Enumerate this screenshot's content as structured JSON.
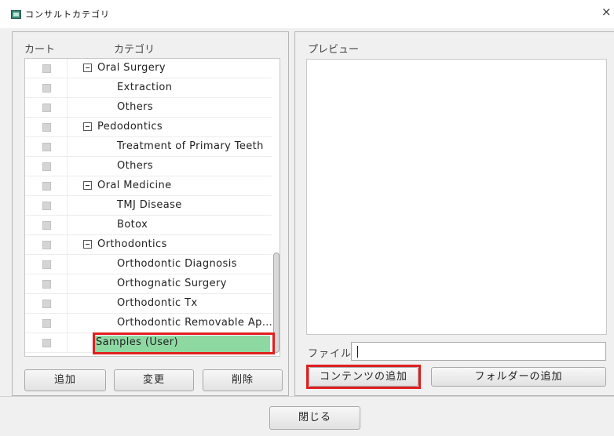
{
  "window": {
    "title": "コンサルトカテゴリ",
    "close_icon": "close-icon"
  },
  "left": {
    "col_cart": "カート",
    "col_category": "カテゴリ",
    "rows": [
      {
        "label": "Oral Surgery",
        "parent": true
      },
      {
        "label": "Extraction",
        "parent": false
      },
      {
        "label": "Others",
        "parent": false
      },
      {
        "label": "Pedodontics",
        "parent": true
      },
      {
        "label": "Treatment of Primary Teeth",
        "parent": false
      },
      {
        "label": "Others",
        "parent": false
      },
      {
        "label": "Oral Medicine",
        "parent": true
      },
      {
        "label": "TMJ Disease",
        "parent": false
      },
      {
        "label": "Botox",
        "parent": false
      },
      {
        "label": "Orthodontics",
        "parent": true
      },
      {
        "label": "Orthodontic Diagnosis",
        "parent": false
      },
      {
        "label": "Orthognatic Surgery",
        "parent": false
      },
      {
        "label": "Orthodontic Tx",
        "parent": false
      },
      {
        "label": "Orthodontic Removable Ap…",
        "parent": false
      },
      {
        "label": "Samples (User)",
        "parent": false,
        "selected": true
      }
    ],
    "buttons": {
      "add": "追加",
      "change": "変更",
      "delete": "削除"
    }
  },
  "right": {
    "preview_label": "プレビュー",
    "file_label": "ファイル",
    "file_value": "",
    "buttons": {
      "add_content": "コンテンツの追加",
      "add_folder": "フォルダーの追加"
    }
  },
  "footer": {
    "close": "閉じる"
  },
  "colors": {
    "selection": "#8ed9a2",
    "highlight_box": "#e01f1f"
  }
}
